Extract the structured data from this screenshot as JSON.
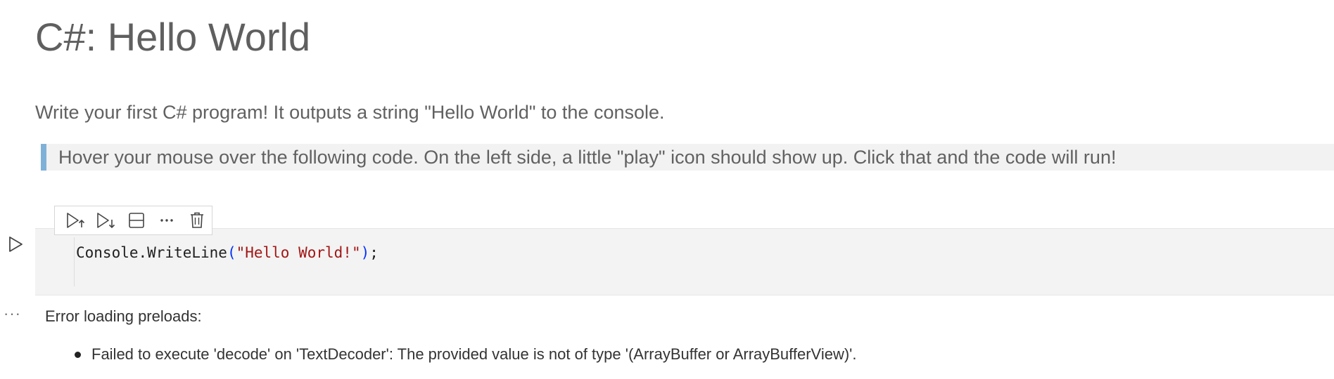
{
  "notebook": {
    "title": "C#: Hello World",
    "intro": "Write your first C# program! It outputs a string \"Hello World\" to the console.",
    "quote": "Hover your mouse over the following code. On the left side, a little \"play\" icon should show up. Click that and the code will run!"
  },
  "cell_toolbar": {
    "icons": [
      "execute-above-icon",
      "execute-below-icon",
      "split-cell-icon",
      "more-actions-icon",
      "delete-icon"
    ]
  },
  "code_cell": {
    "run_icon": "play-icon",
    "tokens": {
      "ident": "Console.WriteLine",
      "open": "(",
      "string": "\"Hello World!\"",
      "close": ")",
      "end": ";"
    },
    "colors": {
      "string": "#a31515",
      "paren": "#0431fa",
      "background": "#f3f3f3"
    }
  },
  "output": {
    "more_icon": "ellipsis-icon",
    "heading": "Error loading preloads:",
    "errors": [
      "Failed to execute 'decode' on 'TextDecoder': The provided value is not of type '(ArrayBuffer or ArrayBufferView)'."
    ]
  },
  "colors": {
    "quote_bar": "#7fb1d8",
    "quote_background": "#f2f2f2"
  }
}
